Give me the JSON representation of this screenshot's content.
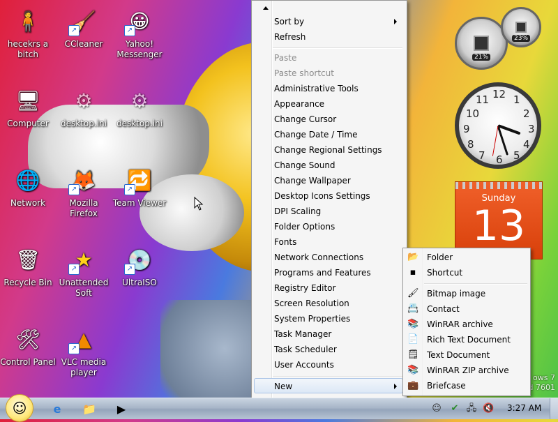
{
  "desktop": {
    "icons": [
      {
        "label": "hecekrs a bitch",
        "icon": "person-icon"
      },
      {
        "label": "CCleaner",
        "icon": "ccleaner-icon"
      },
      {
        "label": "Yahoo! Messenger",
        "icon": "yahoo-messenger-icon"
      },
      {
        "label": "Computer",
        "icon": "computer-icon"
      },
      {
        "label": "desktop.ini",
        "icon": "settings-file-icon"
      },
      {
        "label": "desktop.ini",
        "icon": "settings-file-icon"
      },
      {
        "label": "Network",
        "icon": "network-icon"
      },
      {
        "label": "Mozilla Firefox",
        "icon": "firefox-icon"
      },
      {
        "label": "Team Viewer",
        "icon": "teamviewer-icon"
      },
      {
        "label": "Recycle Bin",
        "icon": "recycle-bin-icon"
      },
      {
        "label": "Unattended Soft",
        "icon": "star-icon"
      },
      {
        "label": "UltraISO",
        "icon": "disc-icon"
      },
      {
        "label": "Control Panel",
        "icon": "control-panel-icon"
      },
      {
        "label": "VLC media player",
        "icon": "vlc-icon"
      }
    ]
  },
  "gadgets": {
    "cpu_percent": "21%",
    "memory_percent": "23%",
    "calendar_day": "Sunday",
    "calendar_date": "13",
    "clock_numbers": [
      "12",
      "1",
      "2",
      "3",
      "4",
      "5",
      "6",
      "7",
      "8",
      "9",
      "10",
      "11"
    ]
  },
  "context_menu": {
    "items": [
      {
        "label": "Sort by",
        "state": "normal",
        "submenu": true
      },
      {
        "label": "Refresh",
        "state": "normal"
      },
      {
        "label": "Paste",
        "state": "disabled"
      },
      {
        "label": "Paste shortcut",
        "state": "disabled"
      },
      {
        "label": "Administrative Tools",
        "state": "normal"
      },
      {
        "label": "Appearance",
        "state": "normal"
      },
      {
        "label": "Change Cursor",
        "state": "normal"
      },
      {
        "label": "Change Date / Time",
        "state": "normal"
      },
      {
        "label": "Change Regional Settings",
        "state": "normal"
      },
      {
        "label": "Change Sound",
        "state": "normal"
      },
      {
        "label": "Change Wallpaper",
        "state": "normal"
      },
      {
        "label": "Desktop Icons Settings",
        "state": "normal"
      },
      {
        "label": "DPI Scaling",
        "state": "normal"
      },
      {
        "label": "Folder Options",
        "state": "normal"
      },
      {
        "label": "Fonts",
        "state": "normal"
      },
      {
        "label": "Network Connections",
        "state": "normal"
      },
      {
        "label": "Programs and Features",
        "state": "normal"
      },
      {
        "label": "Registry Editor",
        "state": "normal"
      },
      {
        "label": "Screen Resolution",
        "state": "normal"
      },
      {
        "label": "System Properties",
        "state": "normal"
      },
      {
        "label": "Task Manager",
        "state": "normal"
      },
      {
        "label": "Task Scheduler",
        "state": "normal"
      },
      {
        "label": "User Accounts",
        "state": "normal"
      },
      {
        "label": "New",
        "state": "selected",
        "submenu": true
      }
    ]
  },
  "new_submenu": {
    "items": [
      {
        "label": "Folder",
        "icon": "folder-icon"
      },
      {
        "label": "Shortcut",
        "icon": "shortcut-icon"
      },
      {
        "label": "Bitmap image",
        "icon": "bitmap-icon"
      },
      {
        "label": "Contact",
        "icon": "contact-icon"
      },
      {
        "label": "WinRAR archive",
        "icon": "winrar-icon"
      },
      {
        "label": "Rich Text Document",
        "icon": "rtf-document-icon"
      },
      {
        "label": "Text Document",
        "icon": "text-document-icon"
      },
      {
        "label": "WinRAR ZIP archive",
        "icon": "winrar-zip-icon"
      },
      {
        "label": "Briefcase",
        "icon": "briefcase-icon"
      }
    ]
  },
  "wallpaper_brand": {
    "line1": "ows 7",
    "line2": "d 7601"
  },
  "taskbar": {
    "time": "3:27 AM",
    "pinned": [
      "internet-explorer-icon",
      "windows-explorer-icon",
      "media-player-icon"
    ],
    "tray": [
      "messenger-tray-icon",
      "security-tray-icon",
      "network-tray-icon",
      "volume-muted-icon"
    ]
  },
  "colors": {
    "accent": "#3a7bd5",
    "menu_bg": "#f5f5f5",
    "calendar": "#e8501a"
  }
}
